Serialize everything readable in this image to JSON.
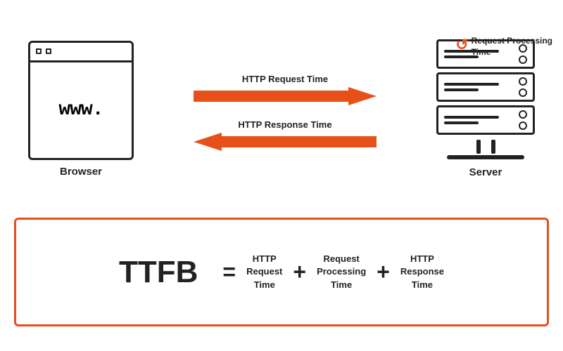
{
  "diagram": {
    "browser": {
      "www_text": "www.",
      "label": "Browser"
    },
    "arrows": {
      "request_label": "HTTP Request Time",
      "response_label": "HTTP Response Time"
    },
    "server": {
      "label": "Server",
      "processing_label": "Request Processing\nTime"
    }
  },
  "formula": {
    "ttfb": "TTFB",
    "equals": "=",
    "plus1": "+",
    "plus2": "+",
    "term1_line1": "HTTP",
    "term1_line2": "Request",
    "term1_line3": "Time",
    "term2_line1": "Request",
    "term2_line2": "Processing",
    "term2_line3": "Time",
    "term3_line1": "HTTP",
    "term3_line2": "Response",
    "term3_line3": "Time"
  },
  "colors": {
    "accent": "#e8501a",
    "dark": "#222222"
  }
}
